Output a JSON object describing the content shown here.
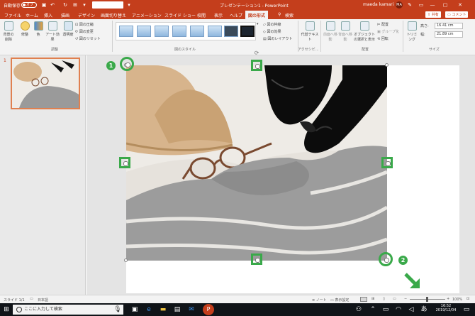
{
  "titlebar": {
    "autosave_label": "自動保存",
    "autosave_state": "オフ",
    "title": "プレゼンテーション1 - PowerPoint",
    "user_name": "maeda kamari",
    "user_initials": "MA"
  },
  "menu": {
    "tabs": [
      "ファイル",
      "ホーム",
      "挿入",
      "描画",
      "デザイン",
      "画面切り替え",
      "アニメーション",
      "スライド ショー",
      "校閲",
      "表示",
      "ヘルプ",
      "図の形式"
    ],
    "search": "検索",
    "share": "共有",
    "comment": "コメント"
  },
  "ribbon": {
    "remove_bg": "背景の削除",
    "corrections": "修整",
    "color": "色",
    "artistic": "アート効果",
    "transparency": "透明度",
    "compress": "図の圧縮",
    "change": "図の変更",
    "reset": "図のリセット",
    "group_adjust": "調整",
    "group_styles": "図のスタイル",
    "border": "図の枠線",
    "effects": "図の効果",
    "layout": "図のレイアウト",
    "alt_text": "代替テキスト",
    "group_access": "アクセシビ...",
    "forward": "前面へ移動",
    "backward": "背面へ移動",
    "selection_pane": "オブジェクトの選択と表示",
    "align": "配置",
    "group": "グループ化",
    "rotate": "回転",
    "group_arrange": "配置",
    "crop": "トリミング",
    "height_label": "高さ:",
    "height_value": "16.41 cm",
    "width_label": "幅:",
    "width_value": "21.89 cm",
    "group_size": "サイズ"
  },
  "thumbnail": {
    "number": "1"
  },
  "annotations": {
    "marker1": "1",
    "marker2": "2"
  },
  "statusbar": {
    "slide_info": "スライド 1/1",
    "language": "日本語",
    "notes": "ノート",
    "display_settings": "表示設定",
    "zoom": "100%"
  },
  "taskbar": {
    "search_placeholder": "ここに入力して検索",
    "time": "16:52",
    "date": "2019/12/04"
  },
  "colors": {
    "accent": "#c43e1c",
    "annotation_green": "#3aa94a"
  }
}
